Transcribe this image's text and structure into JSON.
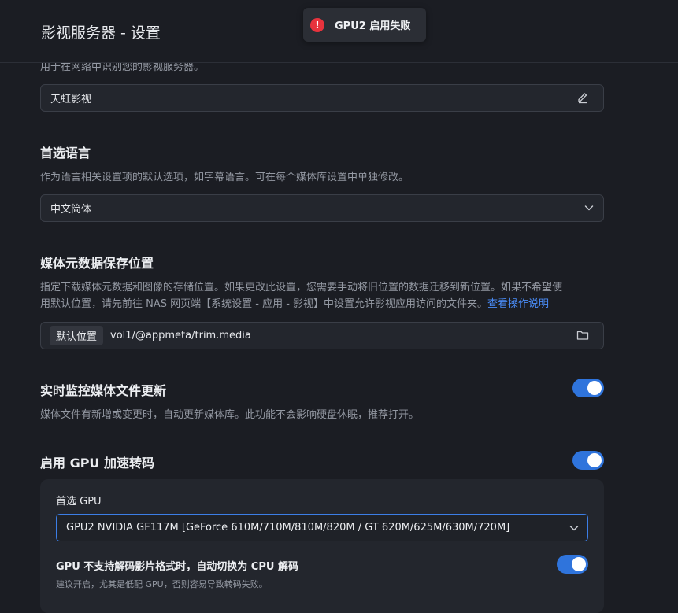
{
  "header": {
    "title": "影视服务器 - 设置"
  },
  "toast": {
    "message": "GPU2 启用失败",
    "icon": "error-icon",
    "icon_glyph": "!",
    "color": "#e8333d"
  },
  "server_name": {
    "description": "用于在网络中识别您的影视服务器。",
    "value": "天虹影视",
    "icon": "edit-icon"
  },
  "language": {
    "title": "首选语言",
    "description": "作为语言相关设置项的默认选项，如字幕语言。可在每个媒体库设置中单独修改。",
    "selected": "中文简体",
    "icon": "chevron-down-icon"
  },
  "metadata_location": {
    "title": "媒体元数据保存位置",
    "description_line1": "指定下载媒体元数据和图像的存储位置。如果更改此设置，您需要手动将旧位置的数据迁移到新位置。如果不希望使",
    "description_line2": "用默认位置，请先前往 NAS 网页端【系统设置 - 应用 - 影视】中设置允许影视应用访问的文件夹。",
    "link_text": "查看操作说明",
    "tag": "默认位置",
    "path": "vol1/@appmeta/trim.media",
    "icon": "folder-icon"
  },
  "realtime_monitor": {
    "title": "实时监控媒体文件更新",
    "description": "媒体文件有新增或变更时，自动更新媒体库。此功能不会影响硬盘休眠，推荐打开。",
    "enabled": true
  },
  "gpu": {
    "title": "启用 GPU 加速转码",
    "enabled": true,
    "preferred_label": "首选 GPU",
    "preferred_value": "GPU2 NVIDIA GF117M [GeForce 610M/710M/810M/820M / GT 620M/625M/630M/720M]",
    "fallback_title": "GPU 不支持解码影片格式时，自动切换为 CPU 解码",
    "fallback_description": "建议开启，尤其是低配 GPU，否则容易导致转码失败。",
    "fallback_enabled": true
  },
  "colors": {
    "background": "#1b1d23",
    "accent": "#2f74dc",
    "link": "#4a8cf7",
    "error": "#e8333d"
  }
}
